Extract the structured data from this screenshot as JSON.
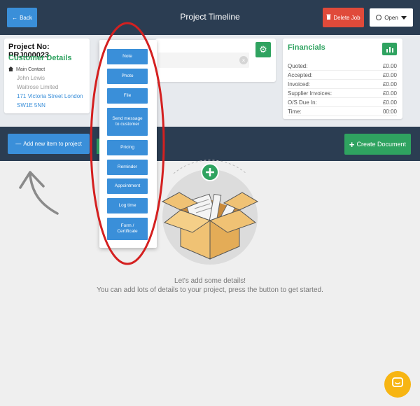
{
  "header": {
    "title": "Project Timeline",
    "back_label": "Back",
    "delete_label": "Delete Job",
    "status_label": "Open"
  },
  "project": {
    "number": "Project No: PRJ000023",
    "customer_heading": "Customer Details",
    "main_contact_label": "Main Contact",
    "contact_name": "John Lewis",
    "company": "Waitrose Limited",
    "address_line1": "171 Victoria Street London",
    "address_line2": "SW1E 5NN"
  },
  "financials": {
    "title": "Financials",
    "rows": [
      {
        "label": "Quoted:",
        "value": "£0.00"
      },
      {
        "label": "Accepted:",
        "value": "£0.00"
      },
      {
        "label": "Invoiced:",
        "value": "£0.00"
      },
      {
        "label": "Supplier Invoices:",
        "value": "£0.00"
      },
      {
        "label": "O/S Due In:",
        "value": "£0.00"
      },
      {
        "label": "Time:",
        "value": "00:00"
      }
    ]
  },
  "actions": {
    "add_item_label": "Add new item to project",
    "create_document_label": "Create Document"
  },
  "menu": {
    "items": [
      {
        "label": "Note"
      },
      {
        "label": "Photo"
      },
      {
        "label": "File"
      },
      {
        "label": "Send message to customer"
      },
      {
        "label": "Pricing"
      },
      {
        "label": "Reminder"
      },
      {
        "label": "Appointment"
      },
      {
        "label": "Log time"
      },
      {
        "label": "Form / Certificate"
      }
    ]
  },
  "empty_state": {
    "line1": "Let's add some details!",
    "line2": "You can add lots of details to your project, press the button to get started."
  },
  "colors": {
    "navy": "#2b3d52",
    "blue": "#3a8fd9",
    "green": "#2fa360",
    "red": "#e04a3a",
    "annotation_red": "#d42020",
    "chat_yellow": "#f7b513"
  },
  "icons": {
    "back": "arrow-left-icon",
    "delete": "trash-icon",
    "status": "radio-circle-icon",
    "settings": "gear-icon",
    "chart": "bar-chart-icon",
    "chat": "chat-bubble-icon"
  }
}
